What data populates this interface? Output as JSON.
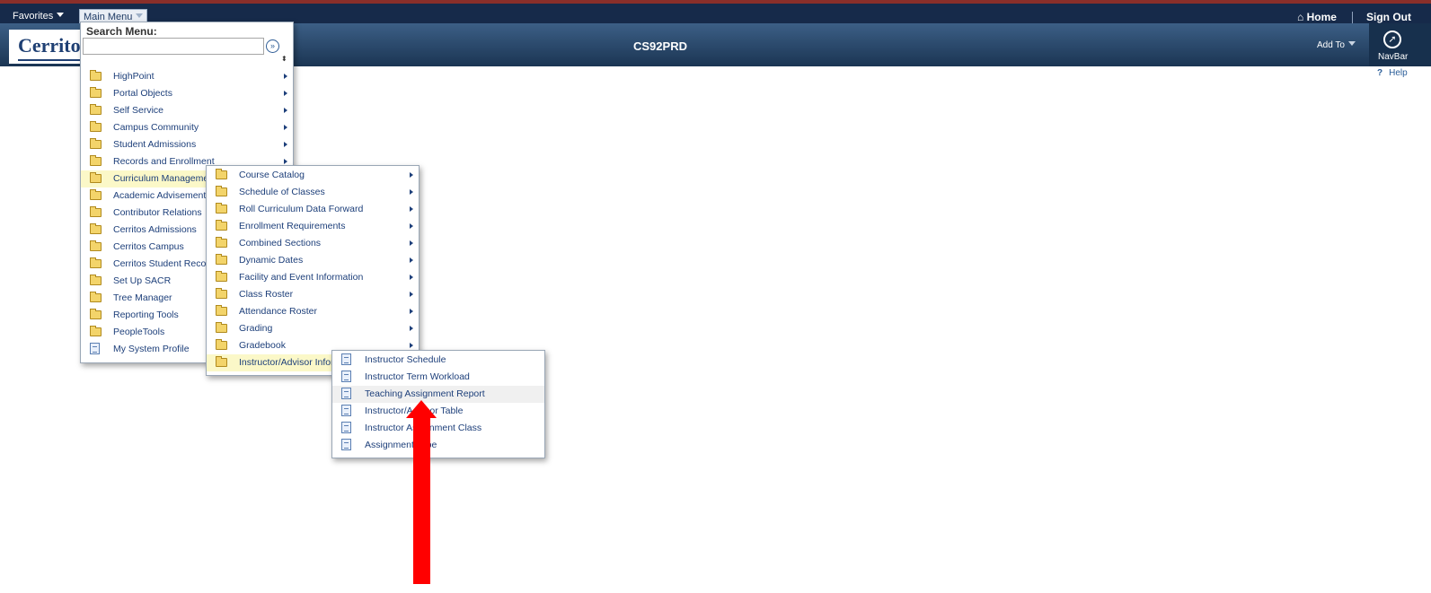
{
  "topbar": {
    "favorites_label": "Favorites",
    "main_menu_label": "Main Menu",
    "home_label": "Home",
    "signout_label": "Sign Out"
  },
  "header": {
    "logo_text": "Cerrito",
    "title": "CS92PRD",
    "add_to_label": "Add To",
    "navbar_label": "NavBar",
    "help_label": "Help",
    "help_glyph": "?"
  },
  "search": {
    "label": "Search Menu:",
    "value": "",
    "go_glyph": "»",
    "sort_glyph": "⬍"
  },
  "main_menu": [
    {
      "label": "HighPoint",
      "icon": "folder",
      "submenu": true
    },
    {
      "label": "Portal Objects",
      "icon": "folder",
      "submenu": true
    },
    {
      "label": "Self Service",
      "icon": "folder",
      "submenu": true
    },
    {
      "label": "Campus Community",
      "icon": "folder",
      "submenu": true
    },
    {
      "label": "Student Admissions",
      "icon": "folder",
      "submenu": true
    },
    {
      "label": "Records and Enrollment",
      "icon": "folder",
      "submenu": true
    },
    {
      "label": "Curriculum Management",
      "icon": "folder",
      "submenu": true,
      "selected": true
    },
    {
      "label": "Academic Advisement",
      "icon": "folder",
      "submenu": true
    },
    {
      "label": "Contributor Relations",
      "icon": "folder",
      "submenu": true
    },
    {
      "label": "Cerritos Admissions",
      "icon": "folder",
      "submenu": true
    },
    {
      "label": "Cerritos Campus",
      "icon": "folder",
      "submenu": true
    },
    {
      "label": "Cerritos Student Records",
      "icon": "folder",
      "submenu": true
    },
    {
      "label": "Set Up SACR",
      "icon": "folder",
      "submenu": true
    },
    {
      "label": "Tree Manager",
      "icon": "folder",
      "submenu": true
    },
    {
      "label": "Reporting Tools",
      "icon": "folder",
      "submenu": true
    },
    {
      "label": "PeopleTools",
      "icon": "folder",
      "submenu": true
    },
    {
      "label": "My System Profile",
      "icon": "document",
      "submenu": false
    }
  ],
  "curriculum_menu": [
    {
      "label": "Course Catalog",
      "icon": "folder",
      "submenu": true
    },
    {
      "label": "Schedule of Classes",
      "icon": "folder",
      "submenu": true
    },
    {
      "label": "Roll Curriculum Data Forward",
      "icon": "folder",
      "submenu": true
    },
    {
      "label": "Enrollment Requirements",
      "icon": "folder",
      "submenu": true
    },
    {
      "label": "Combined Sections",
      "icon": "folder",
      "submenu": true
    },
    {
      "label": "Dynamic Dates",
      "icon": "folder",
      "submenu": true
    },
    {
      "label": "Facility and Event Information",
      "icon": "folder",
      "submenu": true
    },
    {
      "label": "Class Roster",
      "icon": "folder",
      "submenu": true
    },
    {
      "label": "Attendance Roster",
      "icon": "folder",
      "submenu": true
    },
    {
      "label": "Grading",
      "icon": "folder",
      "submenu": true
    },
    {
      "label": "Gradebook",
      "icon": "folder",
      "submenu": true
    },
    {
      "label": "Instructor/Advisor Information",
      "icon": "folder",
      "submenu": true,
      "selected": true
    }
  ],
  "instructor_menu": [
    {
      "label": "Instructor Schedule",
      "icon": "document"
    },
    {
      "label": "Instructor Term Workload",
      "icon": "document"
    },
    {
      "label": "Teaching Assignment Report",
      "icon": "document",
      "hovered": true
    },
    {
      "label": "Instructor/Advisor Table",
      "icon": "document"
    },
    {
      "label": "Instructor Assignment Class",
      "icon": "document"
    },
    {
      "label": "Assignment Type",
      "icon": "document"
    }
  ],
  "colors": {
    "topbar": "#162a4a",
    "header": "#2a4a70",
    "highlight": "#fbf8c8",
    "link": "#1d3f7a",
    "annotation_arrow": "#ff0000"
  }
}
